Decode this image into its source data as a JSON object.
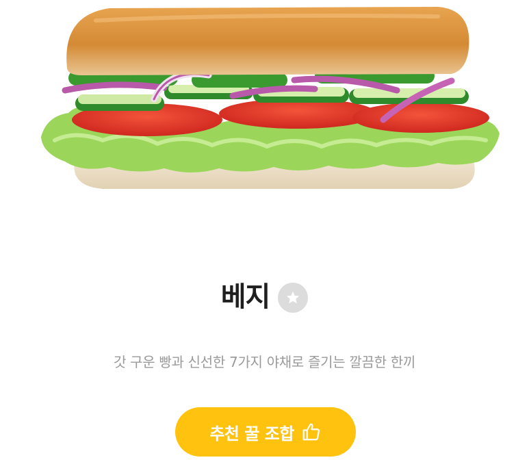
{
  "product": {
    "image_alt": "베지 샌드위치",
    "name": "베지",
    "favorite_icon": "star-icon",
    "description": "갓 구운 빵과 신선한 7가지 야채로 즐기는 깔끔한 한끼"
  },
  "recommend_button": {
    "label": "추천 꿀 조합",
    "icon": "thumbs-up-icon"
  },
  "colors": {
    "accent": "#ffc20f",
    "title": "#1f1f1f",
    "subtitle": "#9a9a9a",
    "badge": "#dcdcdc"
  }
}
